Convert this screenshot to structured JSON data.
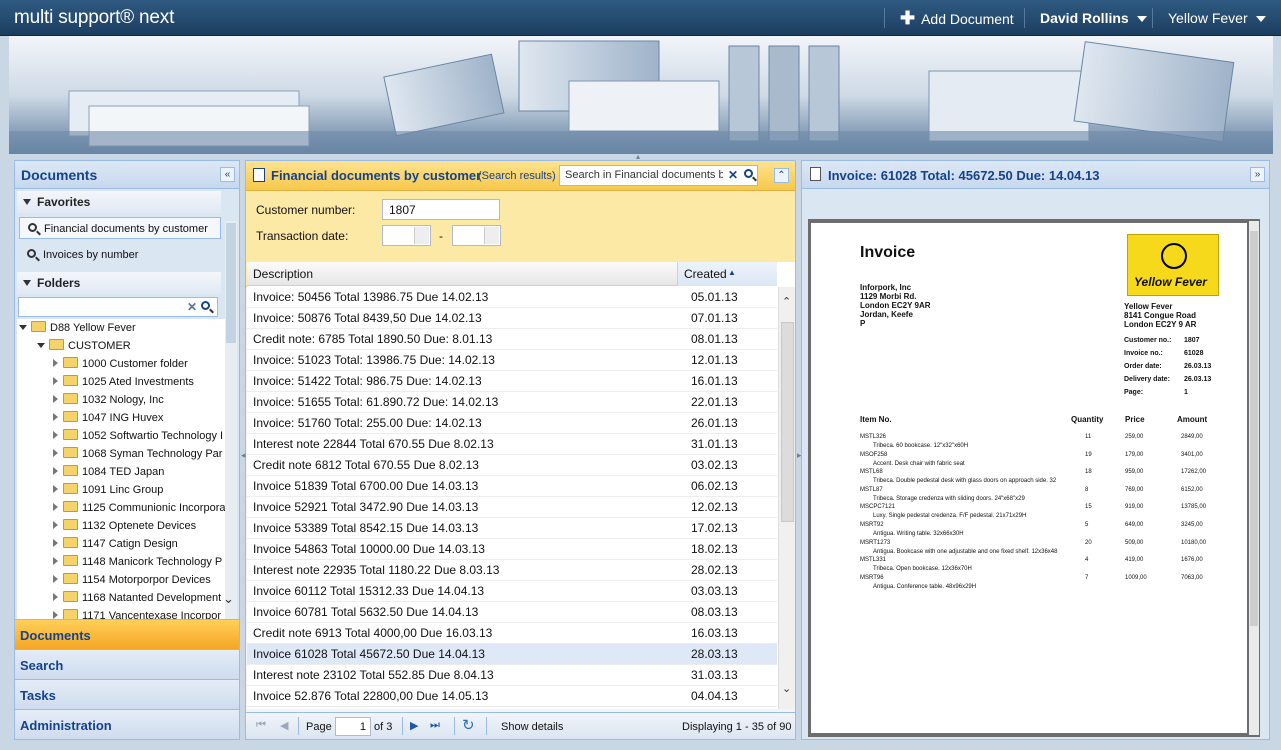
{
  "app": {
    "logo": "multi support® next"
  },
  "topbar": {
    "add_document": "Add Document",
    "user": "David Rollins",
    "org": "Yellow Fever"
  },
  "left": {
    "title": "Documents",
    "favorites_label": "Favorites",
    "favorites": [
      "Financial documents by customer",
      "Invoices by number"
    ],
    "folders_label": "Folders",
    "tree": {
      "root": "D88 Yellow Fever",
      "customer": "CUSTOMER",
      "items": [
        "1000 Customer folder",
        "1025 Ated Investments",
        "1032 Nology, Inc",
        "1047 ING Huvex",
        "1052 Softwartio Technology I",
        "1068 Syman Technology Par",
        "1084 TED Japan",
        "1091 Linc Group",
        "1125 Communionic Incorpora",
        "1132 Optenete Devices",
        "1147 Catign Design",
        "1148 Manicork Technology P",
        "1154 Motorporpor Devices",
        "1168 Natanted Development",
        "1171 Vancentexase Incorpor"
      ]
    },
    "accordion": [
      "Documents",
      "Search",
      "Tasks",
      "Administration"
    ]
  },
  "center": {
    "title": "Financial documents by customer",
    "subtitle": "(Search results)",
    "search_placeholder": "Search in Financial documents by",
    "customer_number_label": "Customer number:",
    "customer_number": "1807",
    "transaction_date_label": "Transaction date:",
    "date_sep": "-",
    "columns": {
      "description": "Description",
      "created": "Created"
    },
    "rows": [
      {
        "d": "Invoice: 50456 Total 13986.75 Due 14.02.13",
        "c": "05.01.13"
      },
      {
        "d": "Invoice: 50876 Total 8439,50 Due 14.02.13",
        "c": "07.01.13"
      },
      {
        "d": "Credit note: 6785 Total 1890.50 Due: 8.01.13",
        "c": "08.01.13"
      },
      {
        "d": "Invoice: 51023 Total: 13986.75 Due: 14.02.13",
        "c": "12.01.13"
      },
      {
        "d": "Invoice: 51422 Total: 986.75 Due: 14.02.13",
        "c": "16.01.13"
      },
      {
        "d": "Invoice: 51655 Total: 61.890.72 Due: 14.02.13",
        "c": "22.01.13"
      },
      {
        "d": "Invoice: 51760 Total: 255.00 Due: 14.02.13",
        "c": "26.01.13"
      },
      {
        "d": "Interest note 22844 Total 670.55 Due 8.02.13",
        "c": "31.01.13"
      },
      {
        "d": "Credit note 6812 Total 670.55 Due 8.02.13",
        "c": "03.02.13"
      },
      {
        "d": "Invoice 51839 Total 6700.00 Due 14.03.13",
        "c": "06.02.13"
      },
      {
        "d": "Invoice 52921 Total 3472.90 Due 14.03.13",
        "c": "12.02.13"
      },
      {
        "d": "Invoice 53389 Total 8542.15 Due 14.03.13",
        "c": "17.02.13"
      },
      {
        "d": "Invoice 54863 Total 10000.00 Due 14.03.13",
        "c": "18.02.13"
      },
      {
        "d": "Interest note 22935 Total 1180.22 Due 8.03.13",
        "c": "28.02.13"
      },
      {
        "d": "Invoice 60112 Total 15312.33 Due 14.04.13",
        "c": "03.03.13"
      },
      {
        "d": "Invoice 60781 Total 5632.50 Due 14.04.13",
        "c": "08.03.13"
      },
      {
        "d": "Credit note 6913 Total 4000,00 Due 16.03.13",
        "c": "16.03.13"
      },
      {
        "d": "Invoice 61028 Total 45672.50 Due 14.04.13",
        "c": "28.03.13"
      },
      {
        "d": "Interest note 23102 Total 552.85 Due 8.04.13",
        "c": "31.03.13"
      },
      {
        "d": "Invoice 52.876 Total 22800,00 Due 14.05.13",
        "c": "04.04.13"
      }
    ],
    "selected_row": 17,
    "pager": {
      "page_label": "Page",
      "page": "1",
      "of": "of 3",
      "show_details": "Show details",
      "displaying": "Displaying 1 - 35 of 90"
    }
  },
  "right": {
    "title": "Invoice: 61028 Total: 45672.50 Due: 14.04.13",
    "invoice": {
      "heading": "Invoice",
      "from": [
        "Inforpork, Inc",
        "1129 Morbi Rd.",
        "London EC2Y 9AR",
        "Jordan, Keefe",
        "P"
      ],
      "logo_text": "Yellow Fever",
      "to": [
        "Yellow Fever",
        "8141 Congue Road",
        "London EC2Y 9 AR"
      ],
      "meta": [
        [
          "Customer no.:",
          "1807"
        ],
        [
          "Invoice no.:",
          "61028"
        ],
        [
          "Order date:",
          "26.03.13"
        ],
        [
          "Delivery date:",
          "26.03.13"
        ],
        [
          "Page:",
          "1"
        ]
      ],
      "cols": [
        "Item No.",
        "Quantity",
        "Price",
        "Amount"
      ],
      "lines": [
        {
          "no": "MSTL326",
          "desc": "Tribeca. 60  bookcase. 12\"x32\"x60H",
          "q": "11",
          "p": "259,00",
          "a": "2849,00"
        },
        {
          "no": "MSOF258",
          "desc": "Accent. Desk chair with fabric seat",
          "q": "19",
          "p": "179,00",
          "a": "3401,00"
        },
        {
          "no": "MSTL68",
          "desc": "Tribeca. Double pedestal desk with glass doors on approach side. 32",
          "q": "18",
          "p": "959,00",
          "a": "17262,00"
        },
        {
          "no": "MSTL87",
          "desc": "Tribeca. Storage credenza with sliding doors. 24\"x68\"x29",
          "q": "8",
          "p": "769,00",
          "a": "6152,00"
        },
        {
          "no": "MSCPC7121",
          "desc": "Luxy. Single pedestal credenza. F/F pedestal. 21x71x29H",
          "q": "15",
          "p": "919,00",
          "a": "13785,00"
        },
        {
          "no": "MSRT92",
          "desc": "Antigua. Writing table. 32x66x30H",
          "q": "5",
          "p": "649,00",
          "a": "3245,00"
        },
        {
          "no": "MSRT1273",
          "desc": "Antigua. Bookcase with one adjustable and one fixed shelf. 12x36x48",
          "q": "20",
          "p": "509,00",
          "a": "10180,00"
        },
        {
          "no": "MSTL331",
          "desc": "Tribeca. Open bookcase. 12x36x70H",
          "q": "4",
          "p": "419,00",
          "a": "1676,00"
        },
        {
          "no": "MSRT96",
          "desc": "Antigua. Conference table. 48x96x29H",
          "q": "7",
          "p": "1009,00",
          "a": "7063,00"
        }
      ]
    }
  }
}
